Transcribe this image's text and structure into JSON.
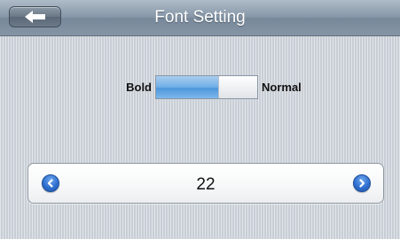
{
  "header": {
    "title": "Font Setting"
  },
  "font_style": {
    "bold_label": "Bold",
    "normal_label": "Normal",
    "selected": "Bold"
  },
  "font_size": {
    "value": "22"
  },
  "icons": {
    "back": "back-arrow-icon",
    "decrease": "chevron-left-icon",
    "increase": "chevron-right-icon"
  },
  "colors": {
    "titlebar": "#8797a8",
    "toggle_active": "#4d97dc",
    "round_button": "#2f6fcf"
  }
}
